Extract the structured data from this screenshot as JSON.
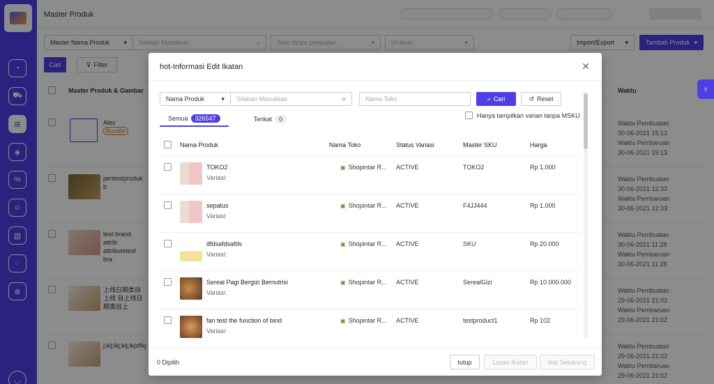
{
  "page": {
    "title": "Master Produk"
  },
  "filters": {
    "field_select": "Master Nama Produk",
    "search_placeholder": "Silakan Masukkan",
    "toko_placeholder": "Toko tanpa penjualan",
    "urutkan_placeholder": "Urutkan",
    "import_export": "Import/Export",
    "tambah_produk": "Tambah Produk",
    "cari": "Cari",
    "filter": "Filter"
  },
  "background_table": {
    "header_product": "Master Produk & Gambar",
    "header_waktu": "Waktu",
    "rows": [
      {
        "name": "Alex",
        "tag": "Bundle",
        "w1": "Waktu Pembuatan",
        "d1": "30-06-2021 15:13",
        "w2": "Waktu Pembaruan",
        "d2": "30-06-2021 15:13"
      },
      {
        "name": "jamtestproduk b",
        "w1": "Waktu Pembuatan",
        "d1": "30-06-2021 12:33",
        "w2": "Waktu Pembaruan",
        "d2": "30-06-2021 12:33"
      },
      {
        "name": "test brand attrib attributetest bra",
        "w1": "Waktu Pembuatan",
        "d1": "30-06-2021 11:28",
        "w2": "Waktu Pembaruan",
        "d2": "30-06-2021 11:28"
      },
      {
        "name": "上线日期类目上线 目上线日期类目上",
        "w1": "Waktu Pembuatan",
        "d1": "29-06-2021 21:02",
        "w2": "Waktu Pembaruan",
        "d2": "29-06-2021 21:02"
      },
      {
        "name": "j;klj;lkj;klj;lkjsflkj",
        "w1": "Waktu Pembuatan",
        "d1": "29-06-2021 21:02",
        "w2": "Waktu Pembaruan",
        "d2": "29-06-2021 21:02"
      }
    ]
  },
  "modal": {
    "title": "hot-Informasi Edit Ikatan",
    "field_select": "Nama Produk",
    "search_placeholder": "Silakan Masukkan",
    "toko_placeholder": "Nama Toko",
    "cari": "Cari",
    "reset": "Reset",
    "tabs": [
      {
        "label": "Semua",
        "count": "326547"
      },
      {
        "label": "Terikat",
        "count": "0"
      }
    ],
    "msku_checkbox": "Hanya tampilkan varian tanpa MSKU",
    "columns": [
      "Nama Produk",
      "Nama Toko",
      "Status Variasi",
      "Master SKU",
      "Harga"
    ],
    "rows": [
      {
        "name": "TOKO2",
        "variasi": "Variasi:",
        "toko": "Shopintar R...",
        "status": "ACTIVE",
        "sku": "TOKO2",
        "harga": "Rp 1.000"
      },
      {
        "name": "sepatus",
        "variasi": "Variasi:",
        "toko": "Shopintar R...",
        "status": "ACTIVE",
        "sku": "F4JJ444",
        "harga": "Rp 1.000"
      },
      {
        "name": "dfdsafdsafds",
        "variasi": "Variasi:",
        "toko": "Shopintar R...",
        "status": "ACTIVE",
        "sku": "SKU",
        "harga": "Rp 20.000"
      },
      {
        "name": "Sereal Pagi Bergizi Bernutrisi",
        "variasi": "Variasi:",
        "toko": "Shopintar R...",
        "status": "ACTIVE",
        "sku": "SerealGizi",
        "harga": "Rp 10.000.000"
      },
      {
        "name": "fan test the function of bind",
        "variasi": "Variasi:",
        "toko": "Shopintar R...",
        "status": "ACTIVE",
        "sku": "testproduct1",
        "harga": "Rp 102"
      }
    ],
    "footer": {
      "selected": "0 Dipilih",
      "tutup": "tutup",
      "lepas": "Lepas Ikatan",
      "ikat": "Ikat Sekarang"
    }
  }
}
